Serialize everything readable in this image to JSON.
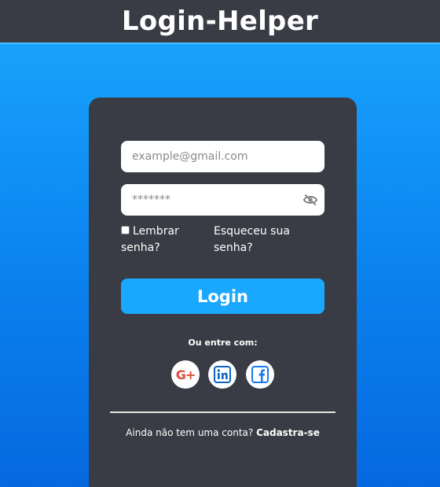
{
  "header": {
    "title": "Login-Helper"
  },
  "form": {
    "email_placeholder": "example@gmail.com",
    "email_value": "",
    "password_placeholder": "*******",
    "password_value": "",
    "remember_label": "Lembrar senha?",
    "remember_checked": false,
    "forgot_label": "Esqueceu sua senha?",
    "login_label": "Login"
  },
  "social": {
    "label": "Ou entre com:",
    "buttons": [
      {
        "icon": "google-plus-icon"
      },
      {
        "icon": "linkedin-icon"
      },
      {
        "icon": "facebook-icon"
      }
    ]
  },
  "signup": {
    "prompt": "Ainda não tem uma conta?",
    "link_label": "Cadastra-se"
  },
  "colors": {
    "background_top": "#1aa8ff",
    "background_bottom": "#0568e0",
    "panel": "#3a3c45",
    "accent": "#1aa8ff",
    "google": "#dd4b39",
    "linkedin": "#0a66c2",
    "facebook": "#1877f2"
  }
}
